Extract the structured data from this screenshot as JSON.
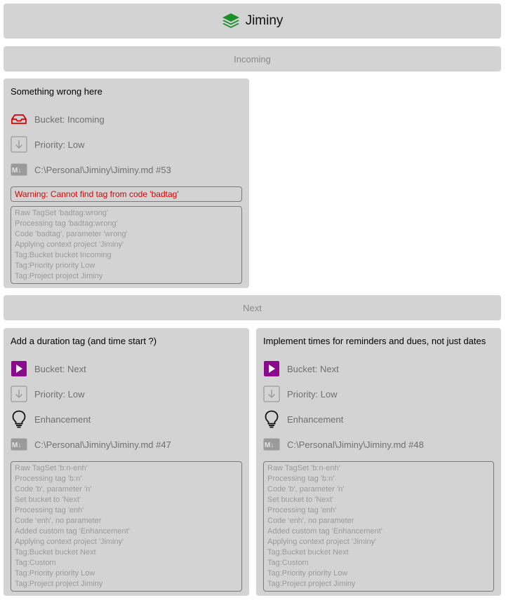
{
  "app": {
    "title": "Jiminy"
  },
  "sections": [
    {
      "label": "Incoming",
      "cards": [
        {
          "title": "Something wrong here",
          "bucket": "Bucket: Incoming",
          "priority": "Priority: Low",
          "file": "C:\\Personal\\Jiminy\\Jiminy.md #53",
          "warning": "Warning: Cannot find tag from code 'badtag'",
          "log": [
            "Raw TagSet 'badtag:wrong'",
            "Processing tag 'badtag:wrong'",
            "Code 'badtag', parameter 'wrong'",
            "Applying context project 'Jiminy'",
            "Tag:Bucket bucket Incoming",
            "Tag:Priority priority Low",
            "Tag:Project project Jiminy"
          ]
        }
      ]
    },
    {
      "label": "Next",
      "cards": [
        {
          "title": "Add a duration tag (and time start ?)",
          "bucket": "Bucket: Next",
          "priority": "Priority: Low",
          "custom": "Enhancement",
          "file": "C:\\Personal\\Jiminy\\Jiminy.md #47",
          "log": [
            "Raw TagSet 'b:n-enh'",
            "Processing tag 'b:n'",
            "Code 'b', parameter 'n'",
            "Set bucket to 'Next'",
            "Processing tag 'enh'",
            "Code 'enh', no parameter",
            "Added custom tag 'Enhancement'",
            "Applying context project 'Jiminy'",
            "Tag:Bucket bucket Next",
            "Tag:Custom",
            "Tag:Priority priority Low",
            "Tag:Project project Jiminy"
          ]
        },
        {
          "title": "Implement times for reminders and dues, not just dates",
          "bucket": "Bucket: Next",
          "priority": "Priority: Low",
          "custom": "Enhancement",
          "file": "C:\\Personal\\Jiminy\\Jiminy.md #48",
          "log": [
            "Raw TagSet 'b:n-enh'",
            "Processing tag 'b:n'",
            "Code 'b', parameter 'n'",
            "Set bucket to 'Next'",
            "Processing tag 'enh'",
            "Code 'enh', no parameter",
            "Added custom tag 'Enhancement'",
            "Applying context project 'Jiminy'",
            "Tag:Bucket bucket Next",
            "Tag:Custom",
            "Tag:Priority priority Low",
            "Tag:Project project Jiminy"
          ]
        }
      ]
    }
  ],
  "icons": {
    "app": "layers-icon",
    "incoming": "inbox-icon",
    "next": "play-icon",
    "priority_low": "arrow-down-icon",
    "enhancement": "lightbulb-icon",
    "file": "markdown-icon"
  },
  "colors": {
    "app_icon": "#1a8f2a",
    "incoming_icon": "#e00000",
    "next_icon": "#8b0a8b",
    "warning_text": "#e00000"
  }
}
